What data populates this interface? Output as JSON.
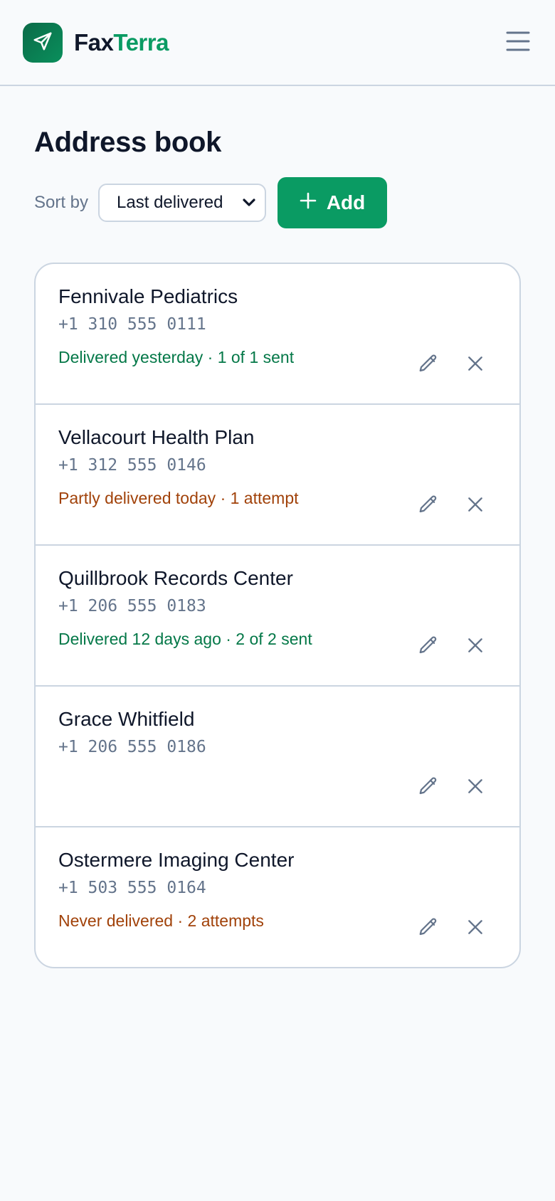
{
  "app": {
    "brand_part1": "Fax",
    "brand_part2": "Terra",
    "logo_icon": "paper-plane-icon",
    "menu_icon": "hamburger-menu-icon"
  },
  "page": {
    "title": "Address book",
    "sort_label": "Sort by",
    "sort_selected": "Last delivered",
    "add_label": "Add"
  },
  "colors": {
    "brand_green": "#0a9b63",
    "status_delivered": "#047848",
    "status_warning": "#a1420a",
    "border": "#cbd5e1",
    "muted_text": "#64748b"
  },
  "contacts": [
    {
      "name": "Fennivale Pediatrics",
      "phone": "+1 310 555 0111",
      "status": "Delivered yesterday · 1 of 1 sent",
      "status_kind": "ok"
    },
    {
      "name": "Vellacourt Health Plan",
      "phone": "+1 312 555 0146",
      "status": "Partly delivered today · 1 attempt",
      "status_kind": "warn"
    },
    {
      "name": "Quillbrook Records Center",
      "phone": "+1 206 555 0183",
      "status": "Delivered 12 days ago · 2 of 2 sent",
      "status_kind": "ok"
    },
    {
      "name": "Grace Whitfield",
      "phone": "+1 206 555 0186",
      "status": "",
      "status_kind": "none"
    },
    {
      "name": "Ostermere Imaging Center",
      "phone": "+1 503 555 0164",
      "status": "Never delivered · 2 attempts",
      "status_kind": "warn"
    }
  ]
}
